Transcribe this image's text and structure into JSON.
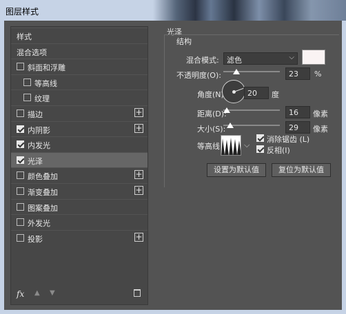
{
  "window": {
    "title": "图层样式"
  },
  "sidebar": {
    "items": [
      {
        "label": "样式",
        "checkbox": false,
        "checked": false,
        "plus": false,
        "selected": false
      },
      {
        "label": "混合选项",
        "checkbox": false,
        "checked": false,
        "plus": false,
        "selected": false
      },
      {
        "label": "斜面和浮雕",
        "checkbox": true,
        "checked": false,
        "plus": false,
        "selected": false
      },
      {
        "label": "等高线",
        "checkbox": true,
        "checked": false,
        "plus": false,
        "selected": false,
        "indent": true
      },
      {
        "label": "纹理",
        "checkbox": true,
        "checked": false,
        "plus": false,
        "selected": false,
        "indent": true
      },
      {
        "label": "描边",
        "checkbox": true,
        "checked": false,
        "plus": true,
        "selected": false
      },
      {
        "label": "内阴影",
        "checkbox": true,
        "checked": true,
        "plus": true,
        "selected": false
      },
      {
        "label": "内发光",
        "checkbox": true,
        "checked": true,
        "plus": false,
        "selected": false
      },
      {
        "label": "光泽",
        "checkbox": true,
        "checked": true,
        "plus": false,
        "selected": true
      },
      {
        "label": "颜色叠加",
        "checkbox": true,
        "checked": false,
        "plus": true,
        "selected": false
      },
      {
        "label": "渐变叠加",
        "checkbox": true,
        "checked": false,
        "plus": true,
        "selected": false
      },
      {
        "label": "图案叠加",
        "checkbox": true,
        "checked": false,
        "plus": false,
        "selected": false
      },
      {
        "label": "外发光",
        "checkbox": true,
        "checked": false,
        "plus": false,
        "selected": false
      },
      {
        "label": "投影",
        "checkbox": true,
        "checked": false,
        "plus": true,
        "selected": false
      }
    ],
    "footer": {
      "fx": "fx"
    }
  },
  "panel": {
    "title": "光泽",
    "group_title": "结构",
    "blend_mode": {
      "label": "混合模式:",
      "value": "滤色",
      "color": "#faf3f3"
    },
    "opacity": {
      "label": "不透明度(O):",
      "value": "23",
      "unit": "%",
      "level": 0.23
    },
    "angle": {
      "label": "角度(N):",
      "value": "20",
      "unit": "度"
    },
    "distance": {
      "label": "距离(D):",
      "value": "16",
      "unit": "像素",
      "level": 0.064
    },
    "size": {
      "label": "大小(S):",
      "value": "29",
      "unit": "像素",
      "level": 0.116
    },
    "contour": {
      "label": "等高线:"
    },
    "anti_alias": {
      "label": "消除锯齿 (L)",
      "checked": true
    },
    "invert": {
      "label": "反相(I)",
      "checked": true
    },
    "make_default": "设置为默认值",
    "reset_default": "复位为默认值"
  }
}
